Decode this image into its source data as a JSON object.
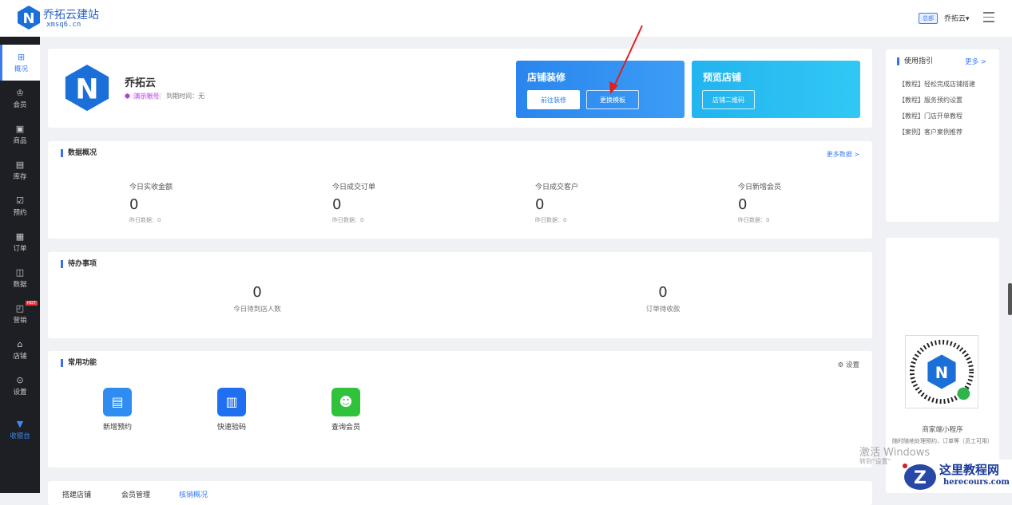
{
  "header": {
    "brand": "乔拓云建站",
    "domain": "xmsq6.cn",
    "hq_badge": "总部",
    "user": "乔拓云▾"
  },
  "sidebar": {
    "items": [
      {
        "label": "概况",
        "icon": "grid-icon"
      },
      {
        "label": "会员",
        "icon": "crown-icon"
      },
      {
        "label": "商品",
        "icon": "box-icon"
      },
      {
        "label": "库存",
        "icon": "inventory-icon"
      },
      {
        "label": "预约",
        "icon": "calendar-check-icon"
      },
      {
        "label": "订单",
        "icon": "order-icon"
      },
      {
        "label": "数据",
        "icon": "chart-icon"
      },
      {
        "label": "营销",
        "icon": "marketing-icon",
        "badge": "HOT"
      },
      {
        "label": "店铺",
        "icon": "store-icon"
      },
      {
        "label": "设置",
        "icon": "gear-icon"
      },
      {
        "label": "收银台",
        "icon": "cashier-icon"
      }
    ]
  },
  "profile": {
    "name": "乔拓云",
    "account_type": "演示帐号",
    "expiry": "到期时间：无"
  },
  "decorate": {
    "title": "店铺装修",
    "btn1": "前往装修",
    "btn2": "更换模板"
  },
  "preview": {
    "title": "预览店铺",
    "btn": "店铺二维码"
  },
  "overview": {
    "title": "数据概况",
    "more": "更多数据 >",
    "stats": [
      {
        "label": "今日实收金额",
        "value": "0",
        "sub": "昨日数据：0"
      },
      {
        "label": "今日成交订单",
        "value": "0",
        "sub": "昨日数据：0"
      },
      {
        "label": "今日成交客户",
        "value": "0",
        "sub": "昨日数据：0"
      },
      {
        "label": "今日新增会员",
        "value": "0",
        "sub": "昨日数据：0"
      }
    ]
  },
  "todo": {
    "title": "待办事项",
    "items": [
      {
        "value": "0",
        "label": "今日待到店人数"
      },
      {
        "value": "0",
        "label": "订单待收款"
      }
    ]
  },
  "common": {
    "title": "常用功能",
    "settings": "设置",
    "items": [
      {
        "label": "新增预约",
        "color": "#2f8cf0"
      },
      {
        "label": "快速验码",
        "color": "#1f6ff0"
      },
      {
        "label": "查询会员",
        "color": "#2fc23a"
      }
    ]
  },
  "bottom_tabs": [
    "搭建店铺",
    "会员管理",
    "核销概况"
  ],
  "guide": {
    "title": "使用指引",
    "more": "更多 >",
    "items": [
      "【教程】轻松完成店铺搭建",
      "【教程】服务预约设置",
      "【教程】门店开单教程",
      "【案例】客户案例推荐"
    ]
  },
  "miniapp": {
    "title": "商家端小程序",
    "desc": "随时随地处理预约、订单等（员工可用）"
  },
  "windows": {
    "line1": "激活 Windows",
    "line2": "转到\"设置\""
  },
  "watermark": {
    "site": "这里教程网",
    "url": "herecours.com"
  }
}
